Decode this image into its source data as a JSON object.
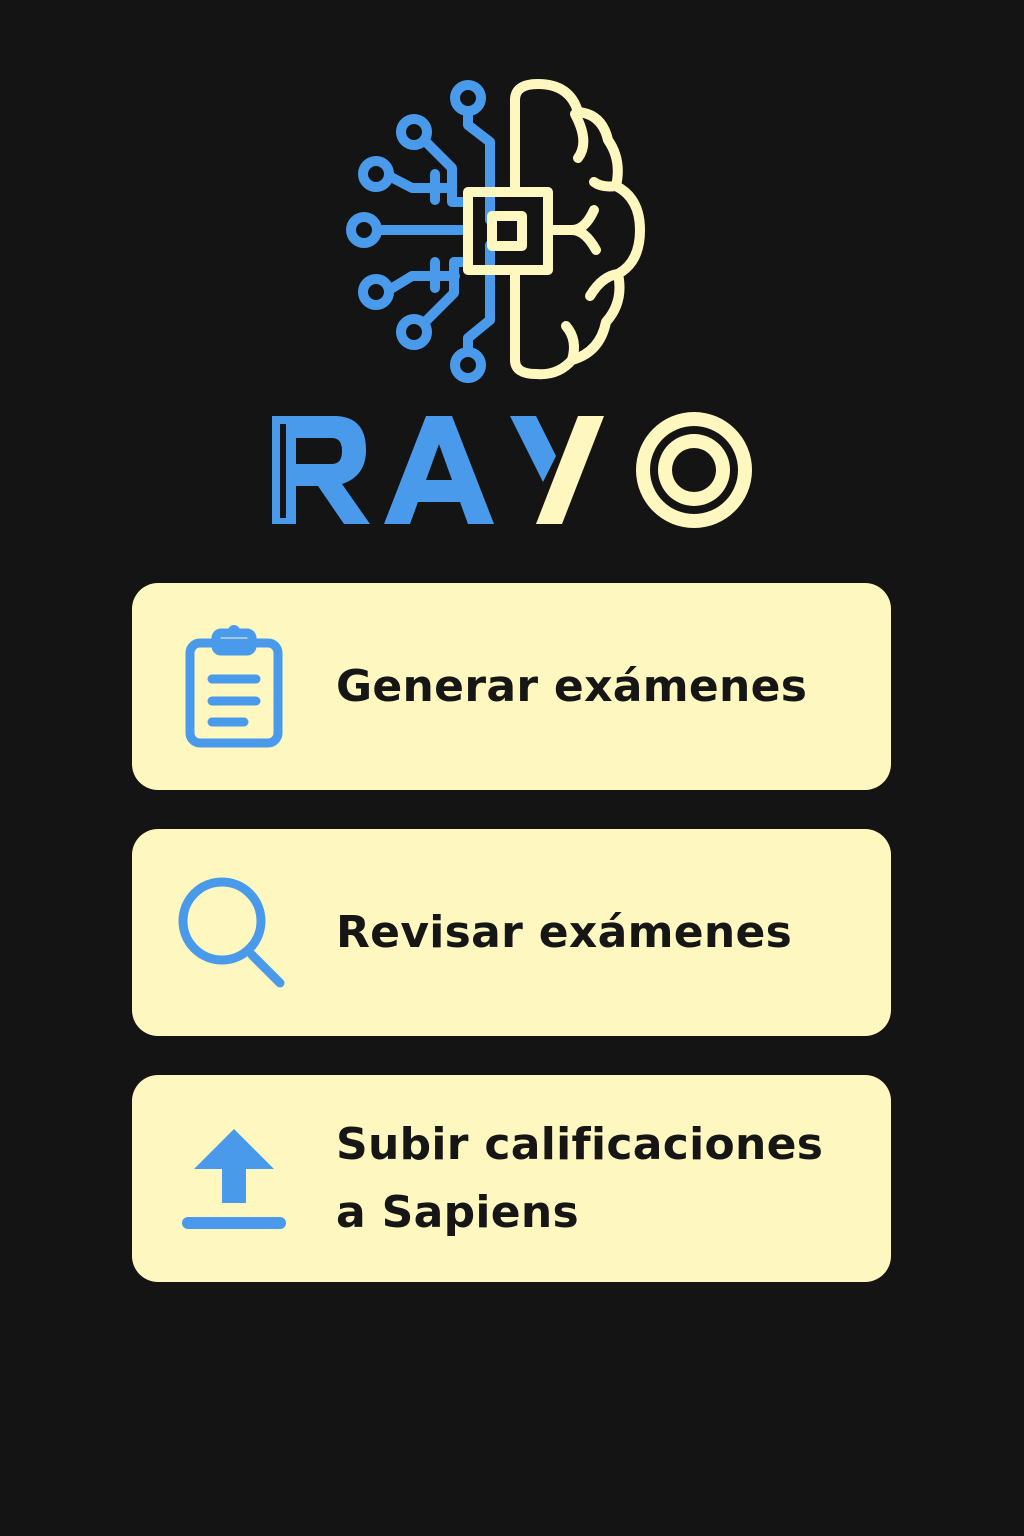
{
  "app": {
    "logo_icon": "brain-circuit-icon",
    "name_letters": [
      "R",
      "A",
      "Y",
      "O"
    ]
  },
  "colors": {
    "background": "#141414",
    "accent_blue": "#4a9aec",
    "accent_cream": "#fef8c0",
    "text_dark": "#161616"
  },
  "menu": {
    "items": [
      {
        "id": "generate",
        "icon": "clipboard-icon",
        "label_lines": [
          "Generar exámenes"
        ]
      },
      {
        "id": "review",
        "icon": "search-icon",
        "label_lines": [
          "Revisar exámenes"
        ]
      },
      {
        "id": "upload",
        "icon": "upload-icon",
        "label_lines": [
          "Subir calificaciones",
          "a Sapiens"
        ]
      }
    ]
  }
}
